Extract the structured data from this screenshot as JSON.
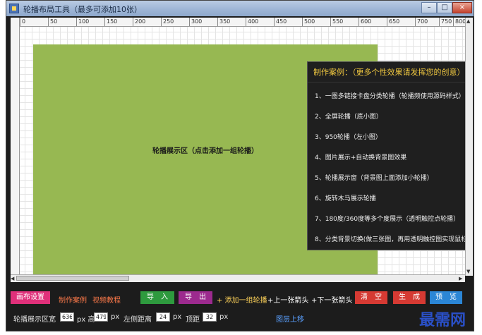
{
  "window": {
    "title": "轮播布局工具（最多可添加10张）",
    "controls": {
      "minimize": "–",
      "maximize": "□",
      "close": "×"
    }
  },
  "ruler": {
    "ticks": [
      "0",
      "50",
      "100",
      "150",
      "200",
      "250",
      "300",
      "350",
      "400",
      "450",
      "500",
      "550",
      "600",
      "650",
      "700",
      "750",
      "800"
    ]
  },
  "slide": {
    "caption": "轮播展示区（点击添加一组轮播）",
    "color": "#97b852"
  },
  "cases_panel": {
    "title": "制作案例：（更多个性效果请发挥您的创意）",
    "items": [
      "1、一图多链接卡盘分类轮播（轮播频使用源码样式）",
      "2、全屏轮播（底小图）",
      "3、950轮播（左小图）",
      "4、图片展示+自动换背景图效果",
      "5、轮播展示窗（背景图上面添加小轮播）",
      "6、旋转木马展示轮播",
      "7、180度/360度等多个度展示（透明触控点轮播）",
      "8、分类背景切换(做三张图，再用透明触控图实现鼠标"
    ]
  },
  "toolbar": {
    "canvas_settings": "画布设置",
    "demo_link": "制作案例",
    "video_link": "视频教程",
    "import": "导　入",
    "export": "导　出",
    "add_group": "+ 添加一组轮播",
    "prev_arrow": "+上一张箭头",
    "next_arrow": "+下一张箭头",
    "clear": "清　空",
    "generate": "生　成",
    "preview": "预　览"
  },
  "status": {
    "width_label": "轮播展示区宽",
    "width_value": "636",
    "height_label": "px 高",
    "height_value": "479",
    "px1": "px",
    "left_label": "左侧距离",
    "left_value": "24",
    "px2": "px",
    "top_label": "顶距",
    "top_value": "32",
    "px3": "px",
    "move_up": "图层上移"
  },
  "watermark": "最需网",
  "colors": {
    "canvas_settings": "#e0307a",
    "import": "#2e9a3e",
    "export": "#9c2a8e",
    "clear": "#d63a33",
    "generate": "#d63a33",
    "preview": "#2b86d6",
    "demo_link": "#ff7a4a",
    "video_link": "#ff7a4a"
  }
}
